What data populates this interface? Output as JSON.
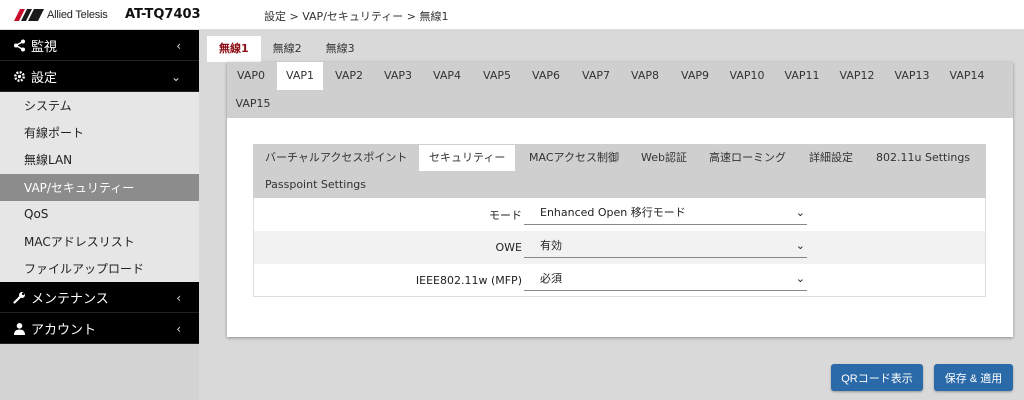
{
  "header": {
    "logo_text": "Allied Telesis",
    "model": "AT-TQ7403",
    "breadcrumb": "設定 > VAP/セキュリティー > 無線1"
  },
  "sidebar": {
    "groups": [
      {
        "label": "監視",
        "icon": "share-icon"
      },
      {
        "label": "設定",
        "icon": "gear-icon"
      },
      {
        "label": "メンテナンス",
        "icon": "wrench-icon"
      },
      {
        "label": "アカウント",
        "icon": "user-icon"
      }
    ],
    "items": [
      {
        "label": "システム"
      },
      {
        "label": "有線ポート"
      },
      {
        "label": "無線LAN"
      },
      {
        "label": "VAP/セキュリティー"
      },
      {
        "label": "QoS"
      },
      {
        "label": "MACアドレスリスト"
      },
      {
        "label": "ファイルアップロード"
      }
    ]
  },
  "radio_tabs": [
    {
      "label": "無線1"
    },
    {
      "label": "無線2"
    },
    {
      "label": "無線3"
    }
  ],
  "vap_tabs": [
    {
      "label": "VAP0"
    },
    {
      "label": "VAP1"
    },
    {
      "label": "VAP2"
    },
    {
      "label": "VAP3"
    },
    {
      "label": "VAP4"
    },
    {
      "label": "VAP5"
    },
    {
      "label": "VAP6"
    },
    {
      "label": "VAP7"
    },
    {
      "label": "VAP8"
    },
    {
      "label": "VAP9"
    },
    {
      "label": "VAP10"
    },
    {
      "label": "VAP11"
    },
    {
      "label": "VAP12"
    },
    {
      "label": "VAP13"
    },
    {
      "label": "VAP14"
    },
    {
      "label": "VAP15"
    }
  ],
  "sub_tabs": [
    {
      "label": "バーチャルアクセスポイント"
    },
    {
      "label": "セキュリティー"
    },
    {
      "label": "MACアクセス制御"
    },
    {
      "label": "Web認証"
    },
    {
      "label": "高速ローミング"
    },
    {
      "label": "詳細設定"
    },
    {
      "label": "802.11u Settings"
    },
    {
      "label": "Passpoint Settings"
    }
  ],
  "form": {
    "mode": {
      "label": "モード",
      "value": "Enhanced Open 移行モード"
    },
    "owe": {
      "label": "OWE",
      "value": "有効"
    },
    "mfp": {
      "label": "IEEE802.11w (MFP)",
      "value": "必須"
    }
  },
  "buttons": {
    "qr": "QRコード表示",
    "save": "保存 & 適用"
  },
  "colors": {
    "accent": "#2a6aa8",
    "active_tab_text": "#8b0e16",
    "sidebar_active": "#8c8c8c"
  }
}
